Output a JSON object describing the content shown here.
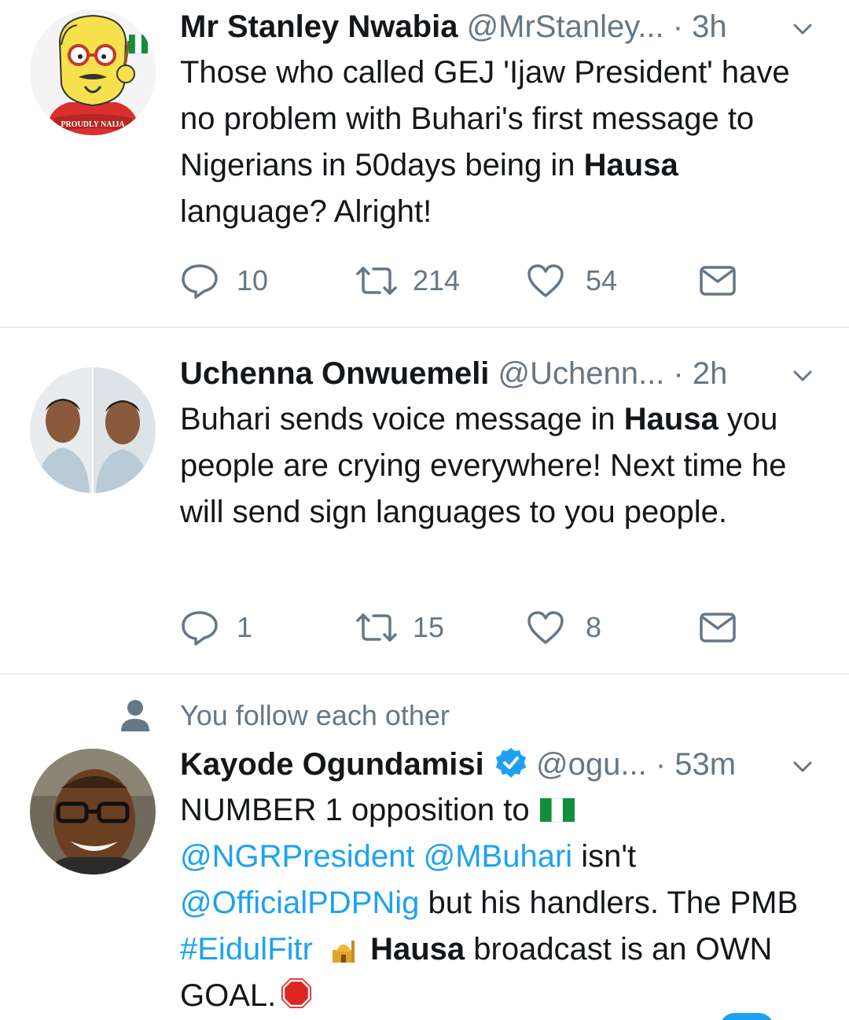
{
  "tweets": [
    {
      "name": "Mr Stanley Nwabia",
      "handle": "@MrStanley...",
      "time": "· 3h",
      "text_before": "Those who called GEJ 'Ijaw President' have no problem with Buhari's first message to Nigerians in 50days being in ",
      "text_bold": "Hausa",
      "text_after": " language? Alright!",
      "avatar_text": "PROUDLY NAIJA",
      "replies": "10",
      "retweets": "214",
      "likes": "54"
    },
    {
      "name": "Uchenna Onwuemeli",
      "handle": "@Uchenn...",
      "time": "· 2h",
      "text_before": "Buhari sends voice message in ",
      "text_bold": "Hausa",
      "text_after": " you people are crying everywhere! Next time he will send sign languages to you people.",
      "replies": "1",
      "retweets": "15",
      "likes": "8"
    },
    {
      "social_context": "You follow each other",
      "name": "Kayode Ogundamisi",
      "handle": "@ogu...",
      "time": "· 53m",
      "text_1": "NUMBER 1 opposition to ",
      "mention_1": "@NGRPresident",
      "mention_2": "@MBuhari",
      "text_2": " isn't",
      "mention_3": "@OfficialPDPNig",
      "text_3": " but his handlers. The PMB ",
      "hashtag": "#EidulFitr",
      "text_bold": "Hausa",
      "text_4": " broadcast is an OWN GOAL."
    }
  ],
  "colors": {
    "accent": "#1da1f2",
    "secondary_text": "#657786",
    "divider": "#e6ecf0",
    "verified": "#1da1f2"
  },
  "icons": [
    "reply-icon",
    "retweet-icon",
    "like-icon",
    "dm-icon",
    "chevron-down-icon",
    "person-icon",
    "verified-badge-icon",
    "nigeria-flag-emoji",
    "mosque-emoji",
    "stop-sign-emoji"
  ]
}
